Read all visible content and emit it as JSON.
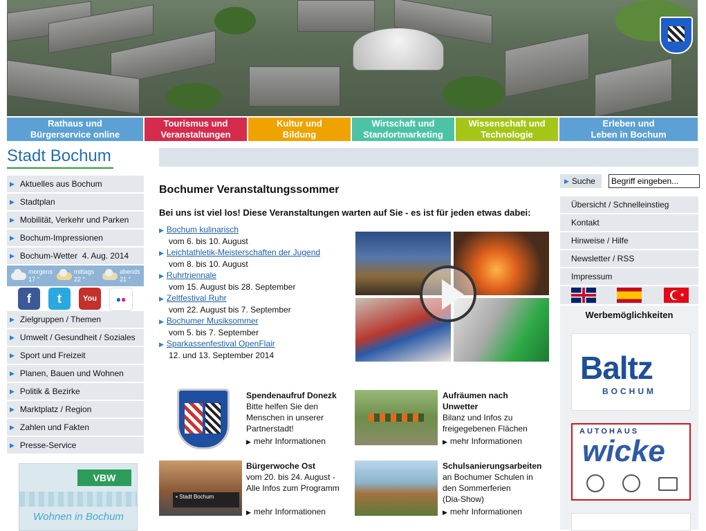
{
  "header": {
    "alt": "Luftbild Bochum",
    "crest": "Bochum Wappen"
  },
  "topnav": [
    {
      "label": "Rathaus und\nBürgerservice online",
      "color": "#5da1d4"
    },
    {
      "label": "Tourismus und\nVeranstaltungen",
      "color": "#d52b4c"
    },
    {
      "label": "Kultur und\nBildung",
      "color": "#efa300"
    },
    {
      "label": "Wirtschaft und\nStandortmarketing",
      "color": "#4cc3a5"
    },
    {
      "label": "Wissenschaft und\nTechnologie",
      "color": "#a5c617"
    },
    {
      "label": "Erleben und\nLeben in Bochum",
      "color": "#5da1d4"
    }
  ],
  "logo": "Stadt Bochum",
  "leftnav_top": [
    "Aktuelles aus Bochum",
    "Stadtplan",
    "Mobilität, Verkehr und Parken",
    "Bochum-Impressionen",
    "Bochum-Wetter  4. Aug. 2014"
  ],
  "weather": [
    {
      "label": "morgens",
      "temp": "17 °"
    },
    {
      "label": "mittags",
      "temp": "22 °"
    },
    {
      "label": "abends",
      "temp": "21 °"
    }
  ],
  "social": [
    {
      "name": "facebook",
      "glyph": "f",
      "color": "#3b5998"
    },
    {
      "name": "twitter",
      "glyph": "t",
      "color": "#2aa9e0"
    },
    {
      "name": "youtube",
      "glyph": "You",
      "color": "#c4302b"
    },
    {
      "name": "flickr",
      "glyph": "●●",
      "color": "#ffffff"
    }
  ],
  "leftnav_bottom": [
    "Zielgruppen / Themen",
    "Umwelt / Gesundheit / Soziales",
    "Sport und Freizeit",
    "Planen, Bauen und Wohnen",
    "Politik & Bezirke",
    "Marktplatz / Region",
    "Zahlen und Fakten",
    "Presse-Service"
  ],
  "left_ad": {
    "brand": "VBW",
    "slogan": "Wohnen in Bochum"
  },
  "main": {
    "title": "Bochumer Veranstaltungssommer",
    "subtitle": "Bei uns ist viel los! Diese Veranstaltungen warten auf Sie - es ist für jeden etwas dabei:",
    "events": [
      {
        "link": "Bochum kulinarisch",
        "date": "vom 6. bis 10. August"
      },
      {
        "link": "Leichtathletik-Meisterschaften der Jugend",
        "date": "vom 8. bis 10. August"
      },
      {
        "link": "Ruhrtriennale",
        "date": "vom 15. August bis 28. September"
      },
      {
        "link": "Zeltfestival Ruhr",
        "date": "vom 22. August bis 7. September"
      },
      {
        "link": "Bochumer Musiksommer",
        "date": "vom 5. bis 7. September"
      },
      {
        "link": "Sparkassenfestival OpenFlair",
        "date": "12. und 13. September 2014"
      }
    ],
    "news": [
      {
        "title": "Spendenaufruf Donezk",
        "text": "Bitte helfen Sie den\nMenschen in unserer\nPartnerstadt!",
        "more": "mehr Informationen"
      },
      {
        "title": "Aufräumen nach\nUnwetter",
        "text": "Bilanz und Infos zu\nfreigegebenen Flächen",
        "more": "mehr Informationen"
      },
      {
        "title": "Bürgerwoche Ost",
        "text": "vom 20. bis 24. August -\nAlle Infos zum Programm",
        "more": "mehr Informationen"
      },
      {
        "title": "Schulsanierungsarbeiten",
        "text": "an Bochumer Schulen in\nden Sommerferien\n(Dia-Show)",
        "more": "mehr Informationen"
      }
    ],
    "thumb_sign": "Stadt Bochum"
  },
  "search": {
    "button": "Suche",
    "placeholder": "Begriff eingeben..."
  },
  "rightnav": [
    "Übersicht / Schnelleinstieg",
    "Kontakt",
    "Hinweise / Hilfe",
    "Newsletter / RSS",
    "Impressum"
  ],
  "flags": [
    "english-flag",
    "spanish-flag",
    "turkish-flag"
  ],
  "werbe": "Werbemöglichkeiten",
  "ads": {
    "baltz": {
      "name": "Baltz",
      "city": "BOCHUM"
    },
    "wicke": {
      "top": "AUTOHAUS",
      "name": "wicke"
    }
  }
}
